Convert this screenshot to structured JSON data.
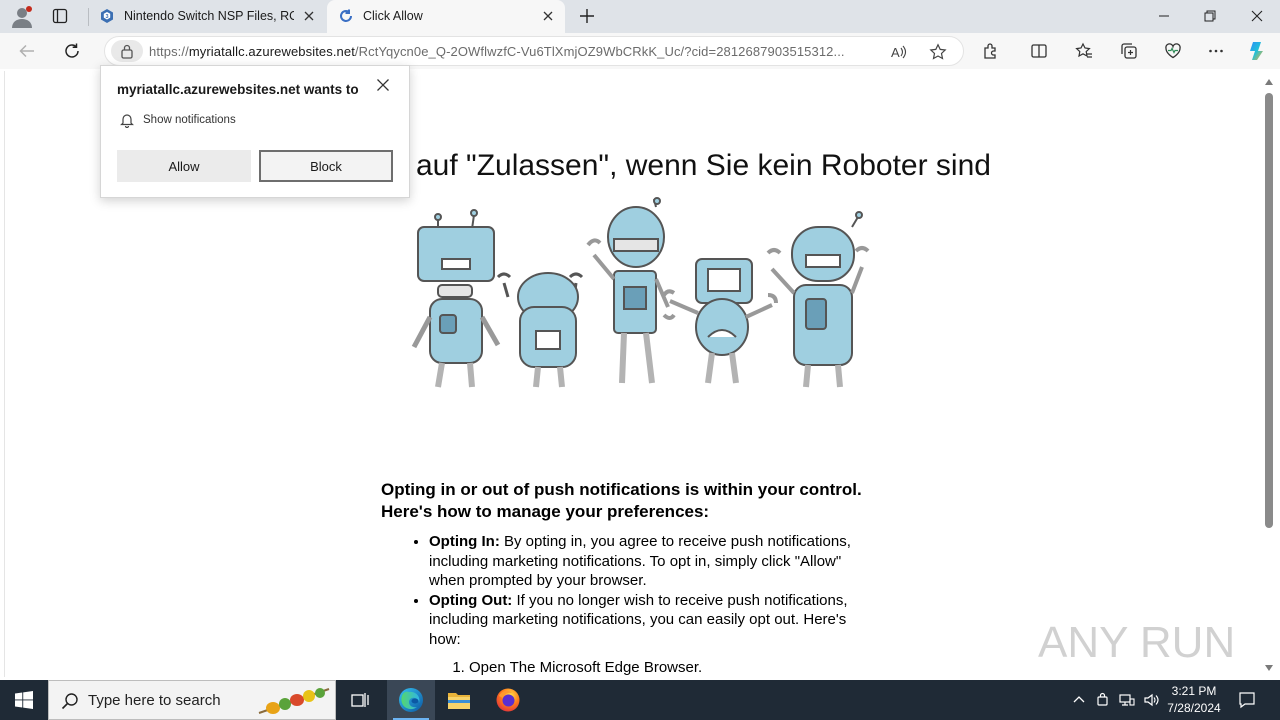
{
  "browser": {
    "tabs": [
      {
        "title": "Nintendo Switch NSP Files, ROM",
        "active": false
      },
      {
        "title": "Click Allow",
        "active": true
      }
    ],
    "url_prefix": "https://",
    "url_host": "myriatallc.azurewebsites.net",
    "url_path": "/RctYqycn0e_Q-2OWflwzfC-Vu6TlXmjOZ9WbCRkK_Uc/?cid=2812687903515312..."
  },
  "permission": {
    "title": "myriatallc.azurewebsites.net wants to",
    "request": "Show notifications",
    "allow_label": "Allow",
    "block_label": "Block"
  },
  "page": {
    "headline": "auf \"Zulassen\", wenn Sie kein Roboter sind",
    "intro": "Opting in or out of push notifications is within your control. Here's how to manage your preferences:",
    "bullets": [
      {
        "term": "Opting In:",
        "text": " By opting in, you agree to receive push notifications, including marketing notifications. To opt in, simply click \"Allow\" when prompted by your browser."
      },
      {
        "term": "Opting Out:",
        "text": " If you no longer wish to receive push notifications, including marketing notifications, you can easily opt out. Here's how:"
      }
    ],
    "steps": [
      "Open The Microsoft Edge Browser."
    ],
    "watermark": "ANY RUN"
  },
  "taskbar": {
    "search_placeholder": "Type here to search",
    "time": "3:21 PM",
    "date": "7/28/2024"
  },
  "colors": {
    "robot_fill": "#9fcfe0",
    "taskbar_bg": "#1f2a36",
    "edge_accent": "#6cb4f3"
  }
}
